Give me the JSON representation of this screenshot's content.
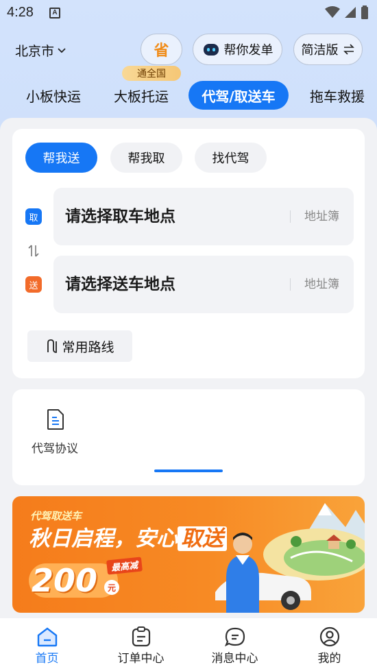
{
  "status_bar": {
    "time": "4:28",
    "notification_letter": "A"
  },
  "header": {
    "city": "北京市",
    "save_label": "省",
    "help_order_label": "帮你发单",
    "simple_mode_label": "简洁版"
  },
  "service_tabs": [
    {
      "label": "小板快运"
    },
    {
      "label": "大板托运",
      "badge": "通全国"
    },
    {
      "label": "代驾/取送车"
    },
    {
      "label": "拖车救援"
    }
  ],
  "modes": [
    {
      "label": "帮我送"
    },
    {
      "label": "帮我取"
    },
    {
      "label": "找代驾"
    }
  ],
  "pickup": {
    "tag": "取",
    "placeholder": "请选择取车地点",
    "address_book": "地址簿"
  },
  "dropoff": {
    "tag": "送",
    "placeholder": "请选择送车地点",
    "address_book": "地址簿"
  },
  "common_routes_label": "常用路线",
  "agreement_label": "代驾协议",
  "banner": {
    "kicker": "代驾取送车",
    "title_prefix": "秋日启程，安心",
    "title_highlight": "取送",
    "max_label": "最高减",
    "amount": "200",
    "unit": "元"
  },
  "bottom_nav": [
    {
      "label": "首页",
      "icon": "home-icon",
      "active": true
    },
    {
      "label": "订单中心",
      "icon": "clipboard-icon"
    },
    {
      "label": "消息中心",
      "icon": "chat-icon"
    },
    {
      "label": "我的",
      "icon": "user-icon"
    }
  ],
  "colors": {
    "accent": "#1677f5",
    "drop_tag": "#f26b2a",
    "banner_orange": "#f57c1b"
  }
}
